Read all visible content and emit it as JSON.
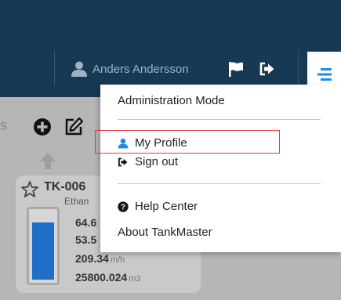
{
  "header": {
    "user_name": "Anders Andersson",
    "icons": {
      "user": "user-icon",
      "flag": "flag-icon",
      "sign_out": "sign-out-icon",
      "menu": "hamburger-menu-icon"
    },
    "colors": {
      "background": "#173954",
      "accent": "#1e8be6"
    }
  },
  "toolbar": {
    "partial_label": "s",
    "icons": {
      "add": "plus-circle-icon",
      "edit": "edit-icon"
    }
  },
  "tank_card": {
    "name": "TK-006",
    "product": "Ethan",
    "level_fraction": 0.85,
    "values": [
      {
        "value": "64.6",
        "unit": ""
      },
      {
        "value": "53.5",
        "unit": ""
      },
      {
        "value": "209.34",
        "unit": "m/h"
      },
      {
        "value": "25800.024",
        "unit": "m3"
      }
    ],
    "colors": {
      "fill": "#1e6fc8"
    }
  },
  "menu": {
    "items": [
      {
        "label": "Administration Mode",
        "icon": ""
      },
      {
        "label": "My Profile",
        "icon": "user-icon"
      },
      {
        "label": "Sign out",
        "icon": "sign-out-icon"
      },
      {
        "label": "Help Center",
        "icon": "question-circle-icon"
      },
      {
        "label": "About TankMaster",
        "icon": ""
      }
    ],
    "highlight_color": "#e53935"
  }
}
